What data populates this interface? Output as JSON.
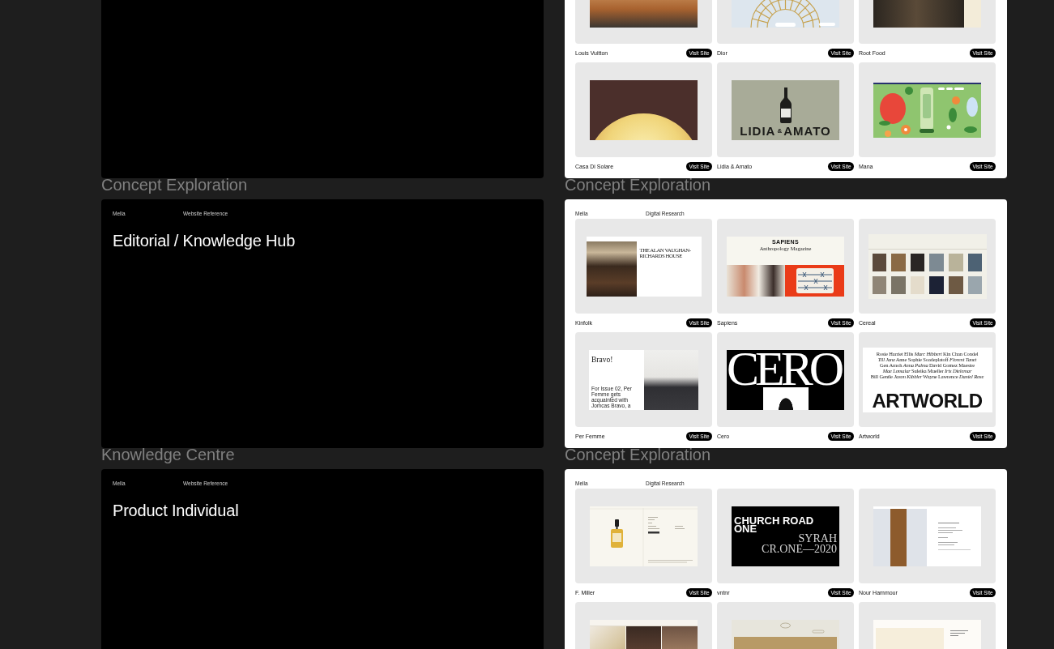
{
  "canvas": {
    "rows": [
      {
        "left": {
          "kind": "hero"
        },
        "right": {
          "kind": "gallery",
          "cards": [
            {
              "name": "Louis Vuitton",
              "button": "Visit Site",
              "thumbnail": {
                "kind": "landscape"
              }
            },
            {
              "name": "Dior",
              "button": "Visit Site",
              "thumbnail": {
                "kind": "arch"
              }
            },
            {
              "name": "Root Food",
              "button": "Visit Site",
              "thumbnail": {
                "kind": "food"
              }
            },
            {
              "name": "Casa Di Solare",
              "button": "Visit Site",
              "thumbnail": {
                "kind": "sun"
              }
            },
            {
              "name": "Lidia & Amato",
              "button": "Visit Site",
              "thumbnail": {
                "kind": "wordmark",
                "words": [
                  "LIDIA",
                  "&",
                  "AMATO"
                ]
              }
            },
            {
              "name": "Mana",
              "button": "Visit Site",
              "thumbnail": {
                "kind": "illustration"
              }
            }
          ]
        }
      },
      {
        "left": {
          "label": "Concept Exploration",
          "kind": "hero",
          "brand": "Mella",
          "category": "Website Reference",
          "title": "Editorial / Knowledge Hub"
        },
        "right": {
          "label": "Concept Exploration",
          "kind": "gallery",
          "brand": "Mella",
          "category": "Digital Research",
          "cards": [
            {
              "name": "Kinfolk",
              "button": "Visit Site",
              "thumbnail": {
                "kind": "split-title",
                "title": "THE ALAN VAUGHAN-RICHARDS HOUSE"
              }
            },
            {
              "name": "Sapiens",
              "button": "Visit Site",
              "thumbnail": {
                "kind": "magazine",
                "title": "SAPIENS",
                "subtitle": "Anthropology Magazine"
              }
            },
            {
              "name": "Cereal",
              "button": "Visit Site",
              "thumbnail": {
                "kind": "photo-grid"
              }
            },
            {
              "name": "Per Femme",
              "button": "Visit Site",
              "thumbnail": {
                "kind": "portrait-feature",
                "headline": "Bravo!",
                "caption": "For Issue 02, Per Femme gets acquainted with Jomcas Bravo, a"
              }
            },
            {
              "name": "Cero",
              "button": "Visit Site",
              "thumbnail": {
                "kind": "cero",
                "title": "CERO"
              }
            },
            {
              "name": "Artworld",
              "button": "Visit Site",
              "thumbnail": {
                "kind": "name-list",
                "lines": [
                  "Rosie Harriet Ellis *Marc Hibbert* Kin Chan Condel",
                  "*Till Janz* Anne Sophie Soadeplatoff *Florent Tanet*",
                  "Gen Arnoh *Anna Palma* David Gomez Maestre",
                  "*Mae Lomalar* Suleika Mueller *Iris Dielemar*",
                  "Bill Gentle *Jason Kibbler* Wayne Lawrence *Daniel Rose*"
                ],
                "wordmark": "ARTWORLD"
              }
            }
          ]
        }
      },
      {
        "left": {
          "label": "Knowledge Centre",
          "kind": "hero",
          "brand": "Mella",
          "category": "Website Reference",
          "title": "Product Individual"
        },
        "right": {
          "label": "Concept Exploration",
          "kind": "gallery",
          "brand": "Mella",
          "category": "Digital Research",
          "cards": [
            {
              "name": "F. Miller",
              "button": "Visit Site",
              "thumbnail": {
                "kind": "product"
              }
            },
            {
              "name": "vntnr",
              "button": "Visit Site",
              "thumbnail": {
                "kind": "wine-title",
                "title": "CHURCH ROAD ONE",
                "wine": "SYRAH",
                "vintage": "CR.ONE—2020"
              }
            },
            {
              "name": "Nour Hammour",
              "button": "Visit Site",
              "thumbnail": {
                "kind": "fashion"
              }
            },
            {
              "thumbnail": {
                "kind": "photo-strip"
              }
            },
            {
              "thumbnail": {
                "kind": "cafe-page"
              }
            },
            {
              "thumbnail": {
                "kind": "shop-page"
              }
            }
          ]
        }
      }
    ]
  }
}
